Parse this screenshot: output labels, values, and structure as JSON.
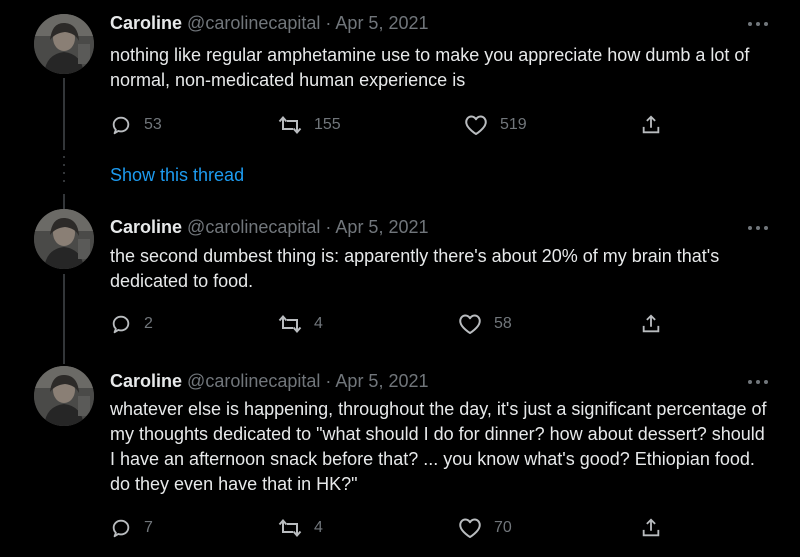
{
  "tweets": [
    {
      "name": "Caroline",
      "handle": "@carolinecapital",
      "separator": "·",
      "date": "Apr 5, 2021",
      "text": "nothing like regular amphetamine use to make you appreciate how dumb a lot of normal, non-medicated human experience is",
      "replies": "53",
      "retweets": "155",
      "likes": "519"
    },
    {
      "name": "Caroline",
      "handle": "@carolinecapital",
      "separator": "·",
      "date": "Apr 5, 2021",
      "text": "the second dumbest thing is: apparently there's about 20% of my brain that's dedicated to food.",
      "replies": "2",
      "retweets": "4",
      "likes": "58"
    },
    {
      "name": "Caroline",
      "handle": "@carolinecapital",
      "separator": "·",
      "date": "Apr 5, 2021",
      "text": "whatever else is happening, throughout the day, it's just a significant percentage of my thoughts dedicated to \"what should I do for dinner? how about dessert? should I have an afternoon snack before that? ... you know what's good? Ethiopian food. do they even have that in HK?\"",
      "replies": "7",
      "retweets": "4",
      "likes": "70"
    }
  ],
  "show_thread_label": "Show this thread",
  "colors": {
    "background": "#000000",
    "text_primary": "#e7e9ea",
    "text_secondary": "#71767b",
    "link": "#1d9bf0",
    "thread_line": "#333639"
  },
  "icons": [
    "reply-icon",
    "retweet-icon",
    "like-icon",
    "share-icon",
    "more-icon"
  ]
}
